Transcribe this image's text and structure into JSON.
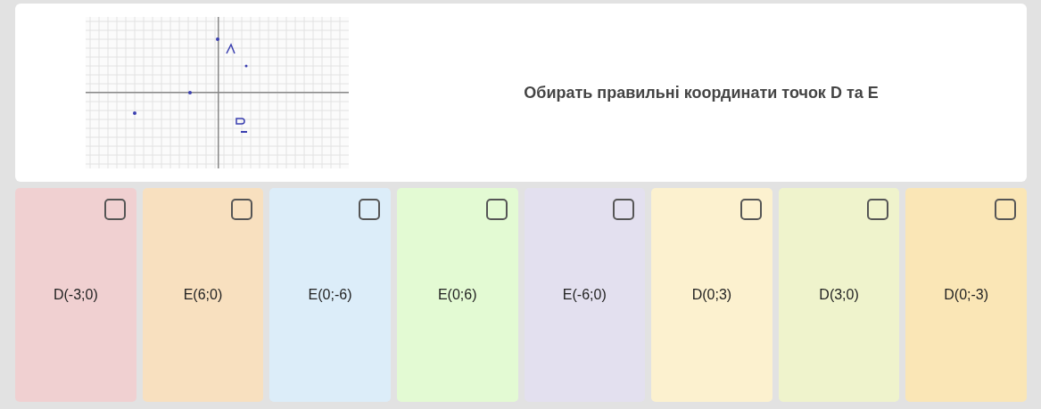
{
  "question": {
    "text": "Обирать правильні координати точок D та E"
  },
  "options": [
    {
      "label": "D(-3;0)",
      "checked": false,
      "color": "#f0d0d1"
    },
    {
      "label": "E(6;0)",
      "checked": false,
      "color": "#f8e0bf"
    },
    {
      "label": "E(0;-6)",
      "checked": false,
      "color": "#dcedf9"
    },
    {
      "label": "E(0;6)",
      "checked": false,
      "color": "#e3fad3"
    },
    {
      "label": "E(-6;0)",
      "checked": false,
      "color": "#e3e0ef"
    },
    {
      "label": "D(0;3)",
      "checked": false,
      "color": "#fcf1cf"
    },
    {
      "label": "D(3;0)",
      "checked": false,
      "color": "#eff3cc"
    },
    {
      "label": "D(0;-3)",
      "checked": false,
      "color": "#fae6b6"
    }
  ]
}
